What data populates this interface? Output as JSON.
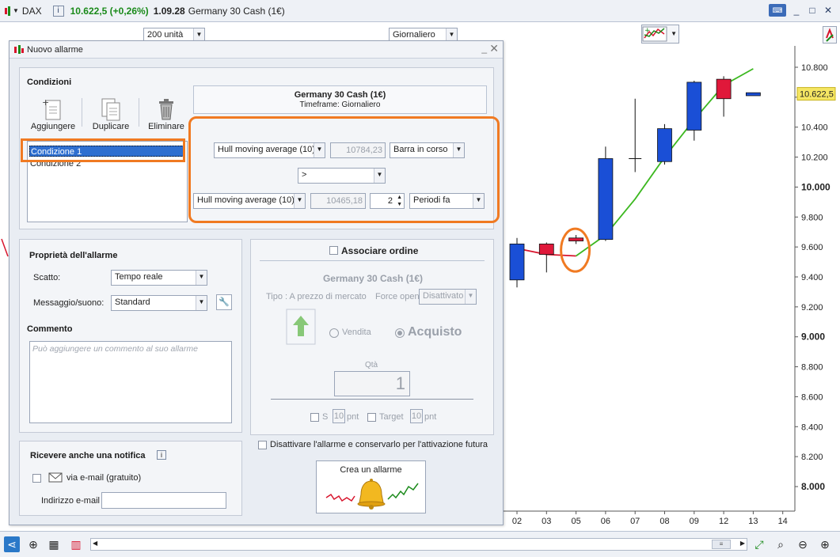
{
  "titlebar": {
    "symbol": "DAX",
    "info_label": "i",
    "price": "10.622,5 (+0,26%)",
    "time": "1.09.28",
    "name": "Germany 30 Cash (1€)",
    "min_label": "_",
    "max_label": "□",
    "close_label": "✕"
  },
  "toolbar": {
    "units_value": "200 unità",
    "timeframe_value": "Giornaliero"
  },
  "dialog": {
    "title": "Nuovo allarme",
    "conditions": {
      "title": "Condizioni",
      "add_label": "Aggiungere",
      "duplicate_label": "Duplicare",
      "delete_label": "Eliminare",
      "items": [
        "Condizione 1",
        "Condizione 2"
      ],
      "header_name": "Germany 30 Cash (1€)",
      "header_timeframe": "Timeframe: Giornaliero",
      "row1_indicator": "Hull moving average (10)",
      "row1_value": "10784,23",
      "row1_bar": "Barra in corso",
      "operator": ">",
      "row2_indicator": "Hull moving average (10)",
      "row2_value": "10465,18",
      "row2_periods": "2",
      "row2_ago": "Periodi fa"
    },
    "properties": {
      "title": "Proprietà dell'allarme",
      "trigger_label": "Scatto:",
      "trigger_value": "Tempo reale",
      "message_label": "Messaggio/suono:",
      "message_value": "Standard",
      "comment_title": "Commento",
      "comment_placeholder": "Può aggiungere un commento al suo allarme"
    },
    "order": {
      "associate_label": "Associare ordine",
      "name": "Germany 30 Cash (1€)",
      "type_label": "Tipo : A prezzo di mercato",
      "force_label": "Force open",
      "force_value": "Disattivato",
      "sell_label": "Vendita",
      "buy_label": "Acquisto",
      "qty_label": "Qtà",
      "qty_value": "1",
      "stop_label": "S",
      "stop_value": "10",
      "stop_unit": "pnt",
      "target_label": "Target",
      "target_value": "10",
      "target_unit": "pnt"
    },
    "deactivate_label": "Disattivare l'allarme e conservarlo per l'attivazione futura",
    "create_label": "Crea un allarme",
    "notify": {
      "title": "Ricevere anche una notifica",
      "email_label": "via e-mail (gratuito)",
      "address_label": "Indirizzo e-mail"
    }
  },
  "chart_data": {
    "type": "candlestick",
    "price_axis_labels": [
      "10.800",
      "10.600",
      "10.400",
      "10.200",
      "10.000",
      "9.800",
      "9.600",
      "9.400",
      "9.200",
      "9.000",
      "8.800",
      "8.600",
      "8.400",
      "8.200",
      "8.000"
    ],
    "current_price_label": "10.622,5",
    "date_labels": [
      "02",
      "03",
      "05",
      "06",
      "07",
      "08",
      "09",
      "12",
      "13",
      "14"
    ],
    "ylim": [
      7900,
      10900
    ],
    "candles": [
      {
        "x": "02",
        "open": 9620,
        "close": 9380,
        "high": 9660,
        "low": 9330,
        "color": "blue"
      },
      {
        "x": "03",
        "open": 9550,
        "close": 9620,
        "high": 9630,
        "low": 9430,
        "color": "red"
      },
      {
        "x": "05",
        "open": 9640,
        "close": 9660,
        "high": 9680,
        "low": 9620,
        "color": "red"
      },
      {
        "x": "06",
        "open": 9650,
        "close": 10190,
        "high": 10270,
        "low": 9640,
        "color": "blue"
      },
      {
        "x": "07",
        "open": 10190,
        "close": 10180,
        "high": 10590,
        "low": 10100,
        "color": "doji"
      },
      {
        "x": "08",
        "open": 10170,
        "close": 10390,
        "high": 10420,
        "low": 10150,
        "color": "blue"
      },
      {
        "x": "09",
        "open": 10380,
        "close": 10700,
        "high": 10710,
        "low": 10310,
        "color": "blue"
      },
      {
        "x": "12",
        "open": 10720,
        "close": 10590,
        "high": 10740,
        "low": 10470,
        "color": "red"
      },
      {
        "x": "13",
        "open": 10610,
        "close": 10630,
        "high": 10630,
        "low": 10610,
        "color": "blue"
      }
    ],
    "hull_ma": {
      "red_segment": [
        [
          "02",
          9590
        ],
        [
          "03",
          9550
        ],
        [
          "05",
          9540
        ]
      ],
      "green_segment": [
        [
          "05",
          9540
        ],
        [
          "06",
          9680
        ],
        [
          "07",
          9920
        ],
        [
          "08",
          10200
        ],
        [
          "09",
          10450
        ],
        [
          "12",
          10680
        ],
        [
          "13",
          10790
        ]
      ]
    }
  },
  "colors": {
    "up": "#1a4fd6",
    "down": "#e0183a",
    "hull_green": "#3cb820",
    "hull_red": "#d8142c",
    "highlight": "#f07a22"
  }
}
